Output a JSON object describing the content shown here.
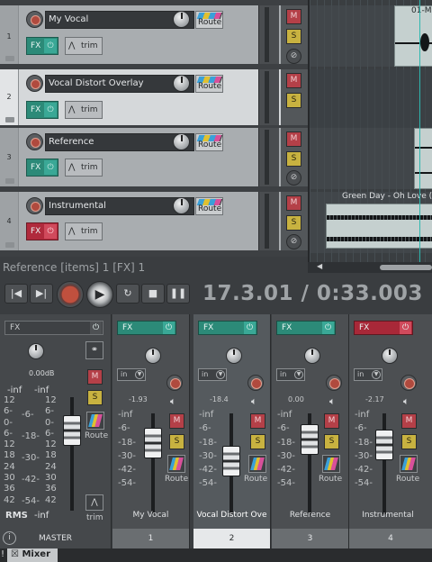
{
  "tracks": [
    {
      "num": "1",
      "name": "My Vocal",
      "route": "Route",
      "fx": "FX",
      "trim": "trim",
      "fx_state": "teal",
      "selected": false
    },
    {
      "num": "2",
      "name": "Vocal Distort Overlay",
      "route": "Route",
      "fx": "FX",
      "trim": "trim",
      "fx_state": "teal",
      "selected": true
    },
    {
      "num": "3",
      "name": "Reference",
      "route": "Route",
      "fx": "FX",
      "trim": "trim",
      "fx_state": "teal",
      "selected": false
    },
    {
      "num": "4",
      "name": "Instrumental",
      "route": "Route",
      "fx": "FX",
      "trim": "trim",
      "fx_state": "red",
      "selected": false
    }
  ],
  "track_buttons": {
    "mute": "M",
    "solo": "S",
    "phase": "⊘"
  },
  "arrange": {
    "item_top_label": "01-M",
    "item_bottom_label": "Green Day - Oh Love (O"
  },
  "status_text": "Reference [items] 1 [FX] 1",
  "transport": {
    "time": "17.3.01 / 0:33.003"
  },
  "mixer": {
    "master": {
      "fx": "FX",
      "db": "0.00dB",
      "left_header": "-inf",
      "right_header": "-inf",
      "left_scale": [
        "12",
        "6-",
        "0-",
        "6-",
        "12",
        "18",
        "24",
        "30",
        "36",
        "42"
      ],
      "right_scale": [
        "-6-",
        "-18-",
        "-30-",
        "-42-",
        "-54-"
      ],
      "mid_scale": [
        "12",
        "6-",
        "0-",
        "6-",
        "12",
        "18",
        "24",
        "30",
        "36",
        "42"
      ],
      "rms_label": "RMS",
      "rms_value": "-inf",
      "route": "Route",
      "trim": "trim",
      "name": "MASTER",
      "mute": "M",
      "solo": "S"
    },
    "strips": [
      {
        "name": "My Vocal",
        "num": "1",
        "vol": "-1.93",
        "in": "in",
        "fx": "FX",
        "fx_state": "teal",
        "route": "Route",
        "mute": "M",
        "solo": "S",
        "scale": [
          "-inf",
          "-6-",
          "-18-",
          "-30-",
          "-42-",
          "-54-"
        ]
      },
      {
        "name": "Vocal Distort Ove",
        "num": "2",
        "vol": "-18.4",
        "in": "in",
        "fx": "FX",
        "fx_state": "teal",
        "route": "Route",
        "mute": "M",
        "solo": "S",
        "scale": [
          "-inf",
          "-6-",
          "-18-",
          "-30-",
          "-42-",
          "-54-"
        ]
      },
      {
        "name": "Reference",
        "num": "3",
        "vol": "0.00",
        "in": "in",
        "fx": "FX",
        "fx_state": "teal",
        "route": "Route",
        "mute": "M",
        "solo": "S",
        "scale": [
          "-inf",
          "-6-",
          "-18-",
          "-30-",
          "-42-",
          "-54-"
        ]
      },
      {
        "name": "Instrumental",
        "num": "4",
        "vol": "-2.17",
        "in": "in",
        "fx": "FX",
        "fx_state": "red",
        "route": "Route",
        "mute": "M",
        "solo": "S",
        "scale": [
          "-inf",
          "-6-",
          "-18-",
          "-30-",
          "-42-",
          "-54-"
        ]
      }
    ]
  },
  "bottom": {
    "tab_label": "Mixer",
    "pin": "!"
  },
  "colors": {
    "fx_teal": "#2c8a78",
    "fx_red": "#b02a3c",
    "mute": "#b44048",
    "solo": "#c8b240",
    "playhead": "#2fb8b0"
  }
}
